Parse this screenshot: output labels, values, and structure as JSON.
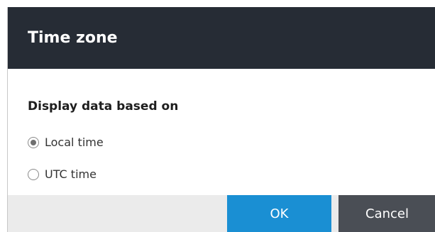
{
  "dialog": {
    "title": "Time zone",
    "section_label": "Display data based on",
    "options": [
      {
        "label": "Local time",
        "selected": true
      },
      {
        "label": "UTC time",
        "selected": false
      }
    ],
    "buttons": {
      "ok_label": "OK",
      "cancel_label": "Cancel"
    }
  },
  "colors": {
    "header_bg": "#262c35",
    "ok_bg": "#1a8fd3",
    "cancel_bg": "#4a4e55",
    "footer_bg": "#ebebeb"
  }
}
